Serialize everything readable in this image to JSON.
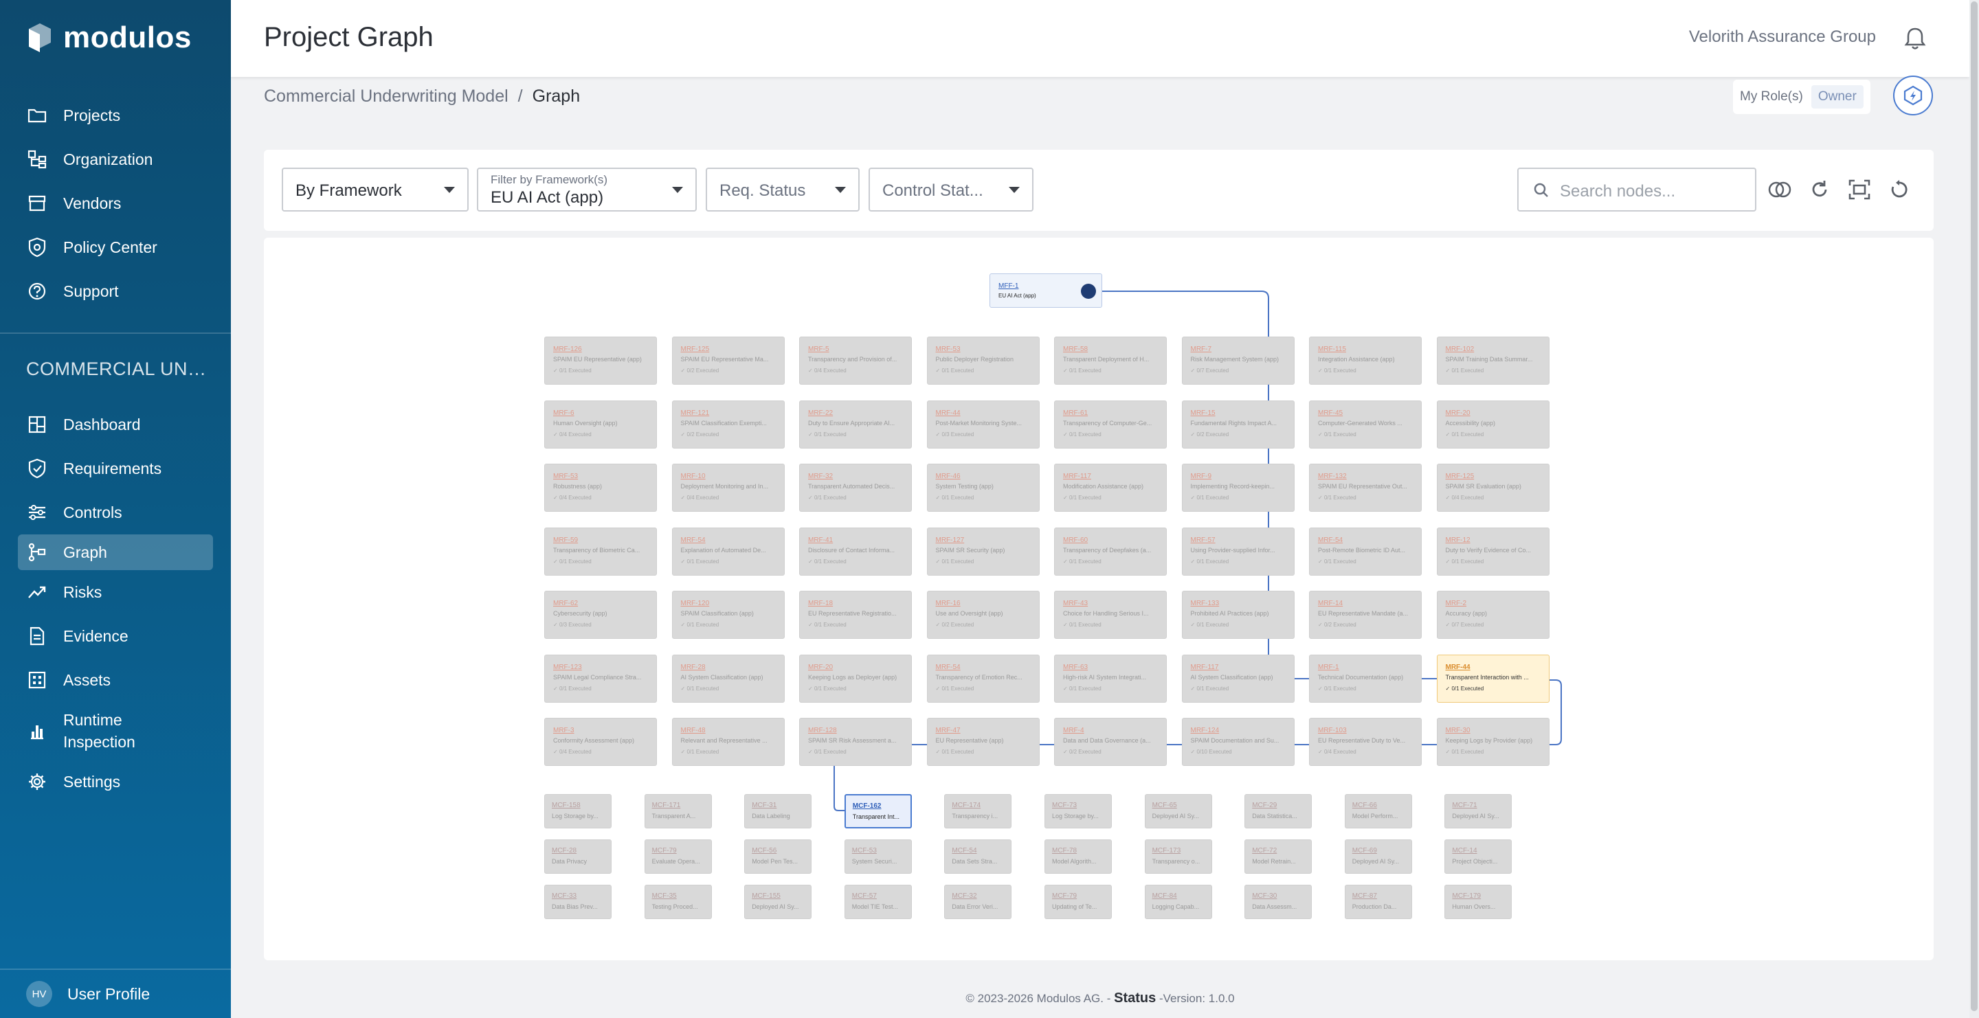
{
  "app": {
    "logo_text": "modulos"
  },
  "sidebar": {
    "main_items": [
      {
        "label": "Projects",
        "icon": "folder-icon"
      },
      {
        "label": "Organization",
        "icon": "org-chart-icon"
      },
      {
        "label": "Vendors",
        "icon": "store-icon"
      },
      {
        "label": "Policy Center",
        "icon": "shield-gear-icon"
      },
      {
        "label": "Support",
        "icon": "help-circle-icon"
      }
    ],
    "section_title": "COMMERCIAL UNDE...",
    "project_items": [
      {
        "label": "Dashboard",
        "icon": "dashboard-icon"
      },
      {
        "label": "Requirements",
        "icon": "shield-check-icon"
      },
      {
        "label": "Controls",
        "icon": "sliders-icon"
      },
      {
        "label": "Graph",
        "icon": "graph-icon",
        "active": true
      },
      {
        "label": "Risks",
        "icon": "trend-up-icon"
      },
      {
        "label": "Evidence",
        "icon": "document-icon"
      },
      {
        "label": "Assets",
        "icon": "grid-icon"
      },
      {
        "label": "Runtime Inspection",
        "icon": "bar-chart-icon"
      },
      {
        "label": "Settings",
        "icon": "gear-icon"
      }
    ],
    "profile": {
      "initials": "HV",
      "label": "User Profile"
    }
  },
  "header": {
    "title": "Project Graph",
    "org_name": "Velorith Assurance Group"
  },
  "breadcrumb": {
    "parent": "Commercial Underwriting Model",
    "separator": "/",
    "current": "Graph"
  },
  "roles": {
    "label": "My Role(s)",
    "value": "Owner"
  },
  "filters": {
    "group_by": "By Framework",
    "framework_label": "Filter by Framework(s)",
    "framework_value": "EU AI Act (app)",
    "req_status": "Req. Status",
    "control_status": "Control Stat...",
    "search_placeholder": "Search nodes..."
  },
  "graph": {
    "root": {
      "id": "MFF-1",
      "title": "EU AI Act (app)"
    },
    "requirements": [
      [
        "MRF-126",
        "SPAIM EU Representative (app)",
        "0/1 Executed"
      ],
      [
        "MRF-125",
        "SPAIM EU Representative Ma...",
        "0/2 Executed"
      ],
      [
        "MRF-5",
        "Transparency and Provision of...",
        "0/4 Executed"
      ],
      [
        "MRF-53",
        "Public Deployer Registration",
        "0/1 Executed"
      ],
      [
        "MRF-58",
        "Transparent Deployment of H...",
        "0/1 Executed"
      ],
      [
        "MRF-7",
        "Risk Management System (app)",
        "0/7 Executed"
      ],
      [
        "MRF-115",
        "Integration Assistance (app)",
        "0/1 Executed"
      ],
      [
        "MRF-102",
        "SPAIM Training Data Summar...",
        "0/1 Executed"
      ],
      [
        "MRF-6",
        "Human Oversight (app)",
        "0/4 Executed"
      ],
      [
        "MRF-121",
        "SPAIM Classification Exempti...",
        "0/2 Executed"
      ],
      [
        "MRF-22",
        "Duty to Ensure Appropriate AI...",
        "0/1 Executed"
      ],
      [
        "MRF-44",
        "Post-Market Monitoring Syste...",
        "0/3 Executed"
      ],
      [
        "MRF-61",
        "Transparency of Computer-Ge...",
        "0/1 Executed"
      ],
      [
        "MRF-15",
        "Fundamental Rights Impact A...",
        "0/2 Executed"
      ],
      [
        "MRF-45",
        "Computer-Generated Works ...",
        "0/1 Executed"
      ],
      [
        "MRF-20",
        "Accessibility (app)",
        "0/1 Executed"
      ],
      [
        "MRF-53",
        "Robustness (app)",
        "0/4 Executed"
      ],
      [
        "MRF-10",
        "Deployment Monitoring and In...",
        "0/4 Executed"
      ],
      [
        "MRF-32",
        "Transparent Automated Decis...",
        "0/1 Executed"
      ],
      [
        "MRF-46",
        "System Testing (app)",
        "0/1 Executed"
      ],
      [
        "MRF-117",
        "Modification Assistance (app)",
        "0/1 Executed"
      ],
      [
        "MRF-9",
        "Implementing Record-keepin...",
        "0/1 Executed"
      ],
      [
        "MRF-132",
        "SPAIM EU Representative Out...",
        "0/1 Executed"
      ],
      [
        "MRF-125",
        "SPAIM SR Evaluation (app)",
        "0/4 Executed"
      ],
      [
        "MRF-59",
        "Transparency of Biometric Ca...",
        "0/1 Executed"
      ],
      [
        "MRF-54",
        "Explanation of Automated De...",
        "0/1 Executed"
      ],
      [
        "MRF-41",
        "Disclosure of Contact Informa...",
        "0/1 Executed"
      ],
      [
        "MRF-127",
        "SPAIM SR Security (app)",
        "0/1 Executed"
      ],
      [
        "MRF-60",
        "Transparency of Deepfakes (a...",
        "0/1 Executed"
      ],
      [
        "MRF-57",
        "Using Provider-supplied Infor...",
        "0/1 Executed"
      ],
      [
        "MRF-54",
        "Post-Remote Biometric ID Aut...",
        "0/1 Executed"
      ],
      [
        "MRF-12",
        "Duty to Verify Evidence of Co...",
        "0/1 Executed"
      ],
      [
        "MRF-62",
        "Cybersecurity (app)",
        "0/3 Executed"
      ],
      [
        "MRF-120",
        "SPAIM Classification (app)",
        "0/1 Executed"
      ],
      [
        "MRF-18",
        "EU Representative Registratio...",
        "0/1 Executed"
      ],
      [
        "MRF-16",
        "Use and Oversight (app)",
        "0/2 Executed"
      ],
      [
        "MRF-43",
        "Choice for Handling Serious I...",
        "0/1 Executed"
      ],
      [
        "MRF-133",
        "Prohibited AI Practices (app)",
        "0/1 Executed"
      ],
      [
        "MRF-14",
        "EU Representative Mandate (a...",
        "0/2 Executed"
      ],
      [
        "MRF-2",
        "Accuracy (app)",
        "0/7 Executed"
      ],
      [
        "MRF-123",
        "SPAIM Legal Compliance Stra...",
        "0/1 Executed"
      ],
      [
        "MRF-28",
        "AI System Classification (app)",
        "0/1 Executed"
      ],
      [
        "MRF-20",
        "Keeping Logs as Deployer (app)",
        "0/1 Executed"
      ],
      [
        "MRF-54",
        "Transparency of Emotion Rec...",
        "0/1 Executed"
      ],
      [
        "MRF-63",
        "High-risk AI System Integrati...",
        "0/1 Executed"
      ],
      [
        "MRF-117",
        "AI System Classification (app)",
        "0/1 Executed"
      ],
      [
        "MRF-1",
        "Technical Documentation (app)",
        "0/1 Executed"
      ],
      [
        "MRF-44",
        "Transparent Interaction with ...",
        "0/1 Executed"
      ],
      [
        "MRF-3",
        "Conformity Assessment (app)",
        "0/4 Executed"
      ],
      [
        "MRF-48",
        "Relevant and Representative ...",
        "0/1 Executed"
      ],
      [
        "MRF-128",
        "SPAIM SR Risk Assessment a...",
        "0/1 Executed"
      ],
      [
        "MRF-47",
        "EU Representative (app)",
        "0/1 Executed"
      ],
      [
        "MRF-4",
        "Data and Data Governance (a...",
        "0/2 Executed"
      ],
      [
        "MRF-124",
        "SPAIM Documentation and Su...",
        "0/10 Executed"
      ],
      [
        "MRF-103",
        "EU Representative Duty to Ve...",
        "0/4 Executed"
      ],
      [
        "MRF-30",
        "Keeping Logs by Provider (app)",
        "0/1 Executed"
      ]
    ],
    "controls": [
      [
        "MCF-158",
        "Log Storage by..."
      ],
      [
        "MCF-171",
        "Transparent A..."
      ],
      [
        "MCF-31",
        "Data Labeling"
      ],
      [
        "MCF-162",
        "Transparent Int..."
      ],
      [
        "MCF-174",
        "Transparency i..."
      ],
      [
        "MCF-73",
        "Log Storage by..."
      ],
      [
        "MCF-65",
        "Deployed AI Sy..."
      ],
      [
        "MCF-29",
        "Data Statistica..."
      ],
      [
        "MCF-66",
        "Model Perform..."
      ],
      [
        "MCF-71",
        "Deployed AI Sy..."
      ],
      [
        "MCF-28",
        "Data Privacy"
      ],
      [
        "MCF-79",
        "Evaluate Opera..."
      ],
      [
        "MCF-56",
        "Model Pen Tes..."
      ],
      [
        "MCF-53",
        "System Securi..."
      ],
      [
        "MCF-54",
        "Data Sets Stra..."
      ],
      [
        "MCF-78",
        "Model Algorith..."
      ],
      [
        "MCF-173",
        "Transparency o..."
      ],
      [
        "MCF-72",
        "Model Retrain..."
      ],
      [
        "MCF-69",
        "Deployed AI Sy..."
      ],
      [
        "MCF-14",
        "Project Objecti..."
      ],
      [
        "MCF-33",
        "Data Bias Prev..."
      ],
      [
        "MCF-35",
        "Testing Proced..."
      ],
      [
        "MCF-155",
        "Deployed AI Sy..."
      ],
      [
        "MCF-57",
        "Model TIE Test..."
      ],
      [
        "MCF-32",
        "Data Error Veri..."
      ],
      [
        "MCF-79",
        "Updating of Te..."
      ],
      [
        "MCF-84",
        "Logging Capab..."
      ],
      [
        "MCF-30",
        "Data Assessm..."
      ],
      [
        "MCF-87",
        "Production Da..."
      ],
      [
        "MCF-179",
        "Human Overs..."
      ]
    ]
  },
  "footer": {
    "copyright": "© 2023-2026 Modulos AG. -",
    "status": "Status",
    "version": "-Version: 1.0.0"
  }
}
